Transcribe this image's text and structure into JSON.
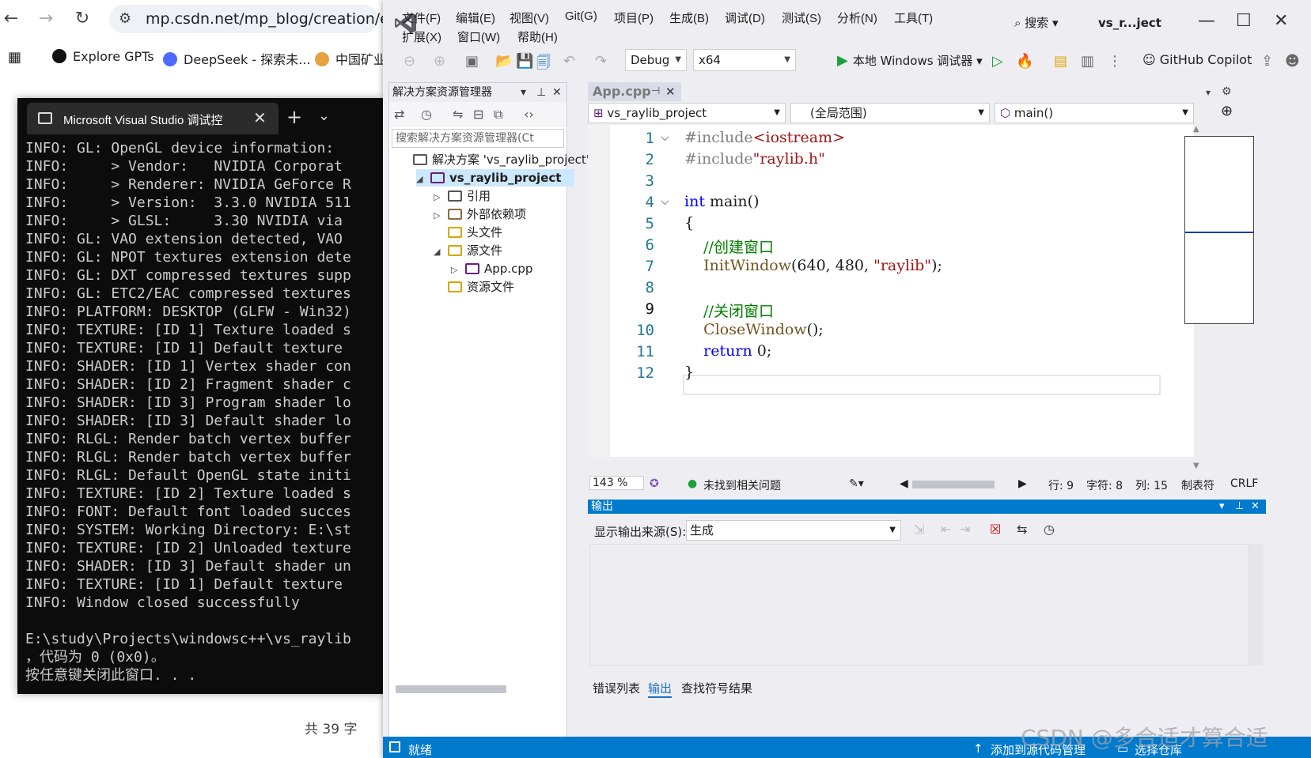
{
  "browser": {
    "url": "mp.csdn.net/mp_blog/creation/edit",
    "bookmarks": [
      {
        "label": "Explore GPTs",
        "color": "#202124"
      },
      {
        "label": "DeepSeek - 探索未...",
        "color": "#4d6bfe"
      },
      {
        "label": "中国矿业",
        "color": "#e6a23c"
      }
    ],
    "word_count": "共 39 字"
  },
  "console": {
    "tab_title": "Microsoft Visual Studio 调试控",
    "lines": [
      "INFO: GL: OpenGL device information:",
      "INFO:     > Vendor:   NVIDIA Corporat",
      "INFO:     > Renderer: NVIDIA GeForce R",
      "INFO:     > Version:  3.3.0 NVIDIA 511",
      "INFO:     > GLSL:     3.30 NVIDIA via",
      "INFO: GL: VAO extension detected, VAO",
      "INFO: GL: NPOT textures extension dete",
      "INFO: GL: DXT compressed textures supp",
      "INFO: GL: ETC2/EAC compressed textures",
      "INFO: PLATFORM: DESKTOP (GLFW - Win32)",
      "INFO: TEXTURE: [ID 1] Texture loaded s",
      "INFO: TEXTURE: [ID 1] Default texture",
      "INFO: SHADER: [ID 1] Vertex shader con",
      "INFO: SHADER: [ID 2] Fragment shader c",
      "INFO: SHADER: [ID 3] Program shader lo",
      "INFO: SHADER: [ID 3] Default shader lo",
      "INFO: RLGL: Render batch vertex buffer",
      "INFO: RLGL: Render batch vertex buffer",
      "INFO: RLGL: Default OpenGL state initi",
      "INFO: TEXTURE: [ID 2] Texture loaded s",
      "INFO: FONT: Default font loaded succes",
      "INFO: SYSTEM: Working Directory: E:\\st",
      "INFO: TEXTURE: [ID 2] Unloaded texture",
      "INFO: SHADER: [ID 3] Default shader un",
      "INFO: TEXTURE: [ID 1] Default texture",
      "INFO: Window closed successfully",
      "",
      "E:\\study\\Projects\\windowsc++\\vs_raylib",
      "，代码为 0 (0x0)。",
      "按任意键关闭此窗口. . ."
    ]
  },
  "vs": {
    "menu_row1": [
      "文件(F)",
      "编辑(E)",
      "视图(V)",
      "Git(G)",
      "项目(P)",
      "生成(B)",
      "调试(D)",
      "测试(S)",
      "分析(N)",
      "工具(T)"
    ],
    "menu_row2": [
      "扩展(X)",
      "窗口(W)",
      "帮助(H)"
    ],
    "search_label": "搜索",
    "project_short": "vs_r...ject",
    "toolbar": {
      "config": "Debug",
      "platform": "x64",
      "run_label": "本地 Windows 调试器",
      "copilot_label": "GitHub Copilot"
    },
    "solution_explorer": {
      "title": "解决方案资源管理器",
      "search_placeholder": "搜索解决方案资源管理器(Ct",
      "items": [
        {
          "label": "解决方案 'vs_raylib_project'",
          "indent": 0,
          "expander": ""
        },
        {
          "label": "vs_raylib_project",
          "indent": 1,
          "expander": "◢"
        },
        {
          "label": "引用",
          "indent": 2,
          "expander": "▷"
        },
        {
          "label": "外部依赖项",
          "indent": 2,
          "expander": "▷"
        },
        {
          "label": "头文件",
          "indent": 2,
          "expander": ""
        },
        {
          "label": "源文件",
          "indent": 2,
          "expander": "◢"
        },
        {
          "label": "App.cpp",
          "indent": 3,
          "expander": "▷"
        },
        {
          "label": "资源文件",
          "indent": 2,
          "expander": ""
        }
      ]
    },
    "editor": {
      "tab_label": "App.cpp",
      "nav_project": "vs_raylib_project",
      "nav_scope": "(全局范围)",
      "nav_member": "main()",
      "current_line": 9,
      "code_lines": [
        [
          {
            "t": "#include",
            "c": "pp"
          },
          {
            "t": "<iostream>",
            "c": "str"
          }
        ],
        [
          {
            "t": "#include",
            "c": "pp"
          },
          {
            "t": "\"raylib.h\"",
            "c": "str"
          }
        ],
        [],
        [
          {
            "t": "int",
            "c": "kw"
          },
          {
            "t": " main()",
            "c": "nm"
          }
        ],
        [
          {
            "t": "{",
            "c": "nm"
          }
        ],
        [
          {
            "t": "    //创建窗口",
            "c": "cm"
          }
        ],
        [
          {
            "t": "    InitWindow",
            "c": "fn"
          },
          {
            "t": "(640, 480, ",
            "c": "nm"
          },
          {
            "t": "\"raylib\"",
            "c": "str"
          },
          {
            "t": ");",
            "c": "nm"
          }
        ],
        [],
        [
          {
            "t": "    //关闭窗口",
            "c": "cm"
          }
        ],
        [
          {
            "t": "    CloseWindow",
            "c": "fn"
          },
          {
            "t": "();",
            "c": "nm"
          }
        ],
        [
          {
            "t": "    return",
            "c": "kw"
          },
          {
            "t": " 0;",
            "c": "nm"
          }
        ],
        [
          {
            "t": "}",
            "c": "nm"
          }
        ]
      ],
      "zoom": "143 %",
      "issues": "未找到相关问题",
      "line_label": "行: 9",
      "char_label": "字符: 8",
      "col_label": "列: 15",
      "tab_mode": "制表符",
      "eol": "CRLF"
    },
    "output": {
      "title": "输出",
      "source_label": "显示输出来源(S):",
      "source_value": "生成",
      "tabs": [
        "错误列表",
        "输出",
        "查找符号结果"
      ]
    },
    "status": {
      "ready": "就绪",
      "add_source": "添加到源代码管理",
      "select_repo": "选择仓库"
    }
  },
  "watermark": "CSDN @多合适才算合适",
  "colors": {
    "vs_blue": "#007acc",
    "console_bg": "#0c0c0c"
  }
}
